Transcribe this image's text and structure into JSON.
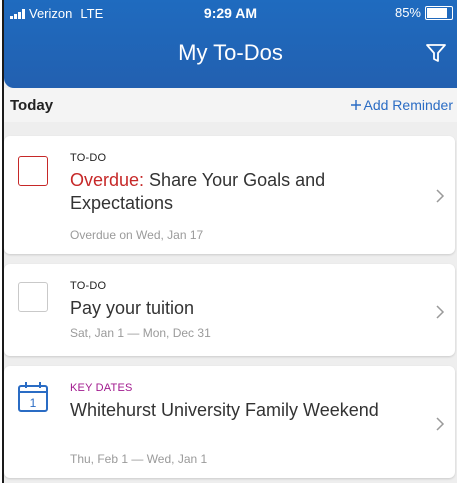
{
  "status_bar": {
    "carrier": "Verizon",
    "network": "LTE",
    "time": "9:29 AM",
    "battery": "85%"
  },
  "header": {
    "title": "My To-Dos"
  },
  "section": {
    "label": "Today",
    "add_reminder": "Add Reminder"
  },
  "cards": [
    {
      "type": "TO-DO",
      "overdue_prefix": "Overdue:",
      "title": " Share Your Goals and Expectations",
      "subtitle": "Overdue on Wed, Jan 17"
    },
    {
      "type": "TO-DO",
      "title": "Pay your tuition",
      "subtitle": "Sat, Jan 1 — Mon, Dec 31"
    },
    {
      "type": "KEY DATES",
      "calendar_day": "1",
      "title": "Whitehurst University Family Weekend",
      "subtitle": "Thu, Feb 1 — Wed, Jan 1"
    }
  ],
  "colors": {
    "header_blue": "#2260b0",
    "overdue_red": "#c62828",
    "link_blue": "#2a6cc4",
    "keydates_purple": "#a11a8e"
  }
}
